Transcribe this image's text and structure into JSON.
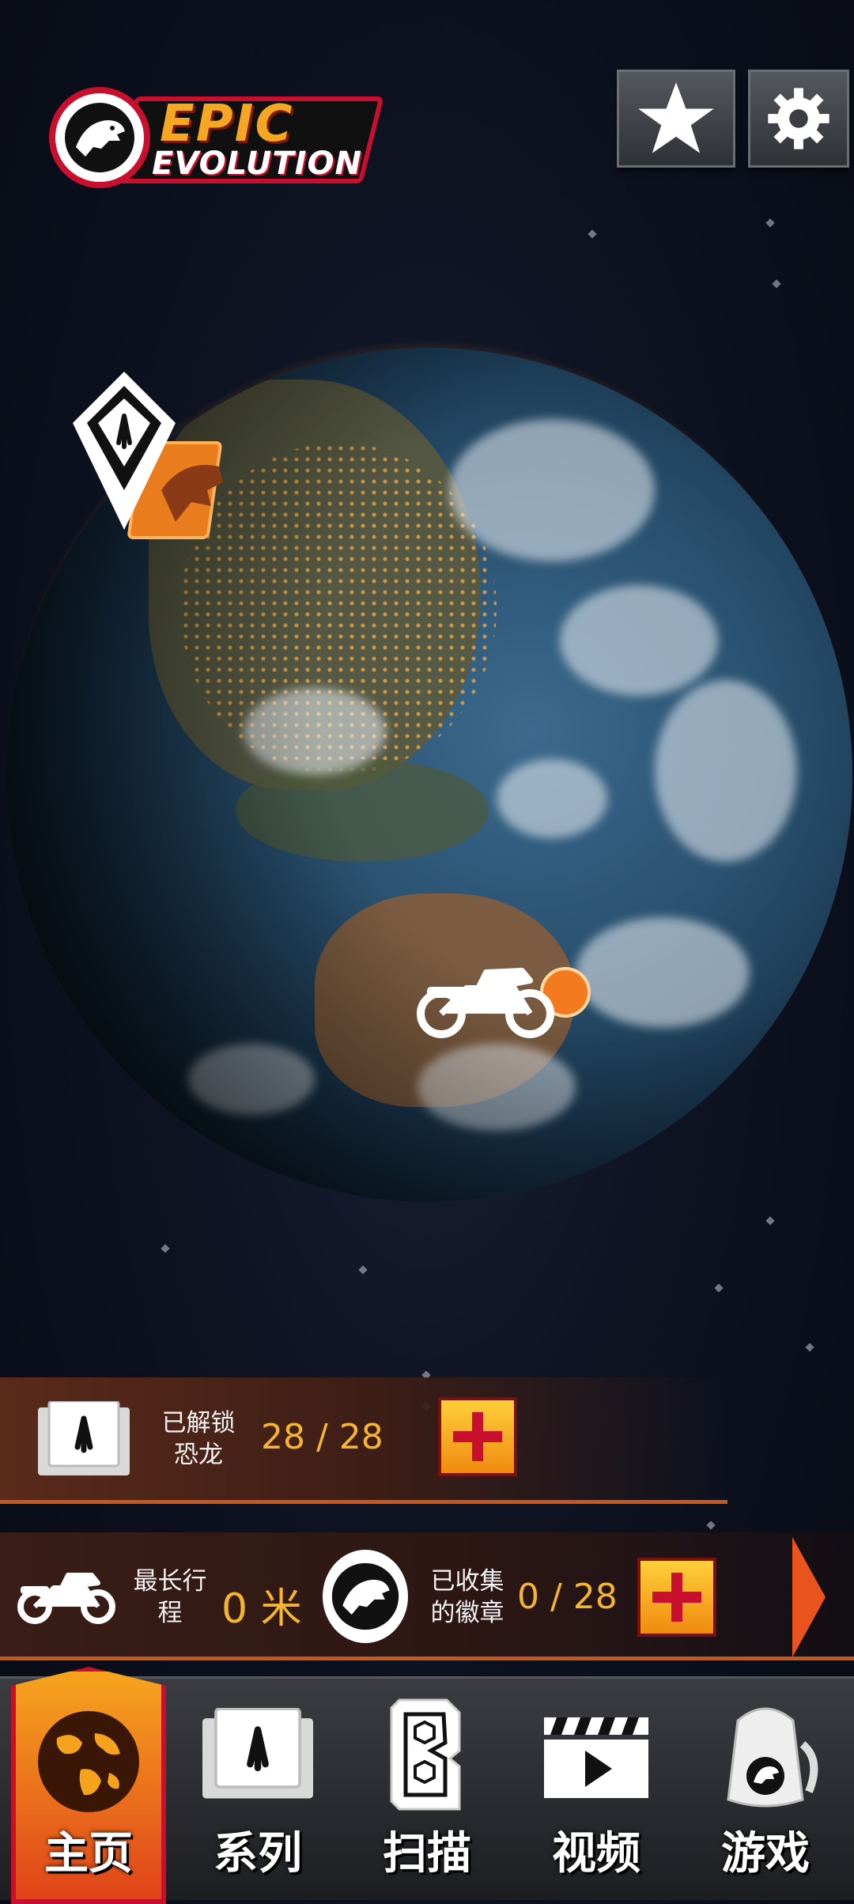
{
  "logo": {
    "line1": "EPIC",
    "line2": "EVOLUTION"
  },
  "top_buttons": [
    {
      "name": "favorites",
      "icon": "star-icon"
    },
    {
      "name": "settings",
      "icon": "gear-icon"
    }
  ],
  "globe": {
    "markers": [
      {
        "name": "dinosaur-location",
        "icon": "dino-footprint-icon"
      },
      {
        "name": "player-location",
        "icon": "motorcycle-icon"
      }
    ]
  },
  "stats": {
    "unlocked_label": "已解锁\n恐龙",
    "unlocked_value": "28 / 28",
    "distance_label": "最长行\n程",
    "distance_value": "0 米",
    "badges_label": "已收集\n的徽章",
    "badges_value": "0 / 28"
  },
  "nav": {
    "items": [
      {
        "label": "主页",
        "icon": "globe-icon",
        "active": true
      },
      {
        "label": "系列",
        "icon": "collection-icon"
      },
      {
        "label": "扫描",
        "icon": "scan-icon"
      },
      {
        "label": "视频",
        "icon": "video-icon"
      },
      {
        "label": "游戏",
        "icon": "backpack-icon"
      }
    ]
  },
  "colors": {
    "accent": "#f5b533",
    "brand_red": "#c8102e",
    "orange": "#e8541b"
  }
}
